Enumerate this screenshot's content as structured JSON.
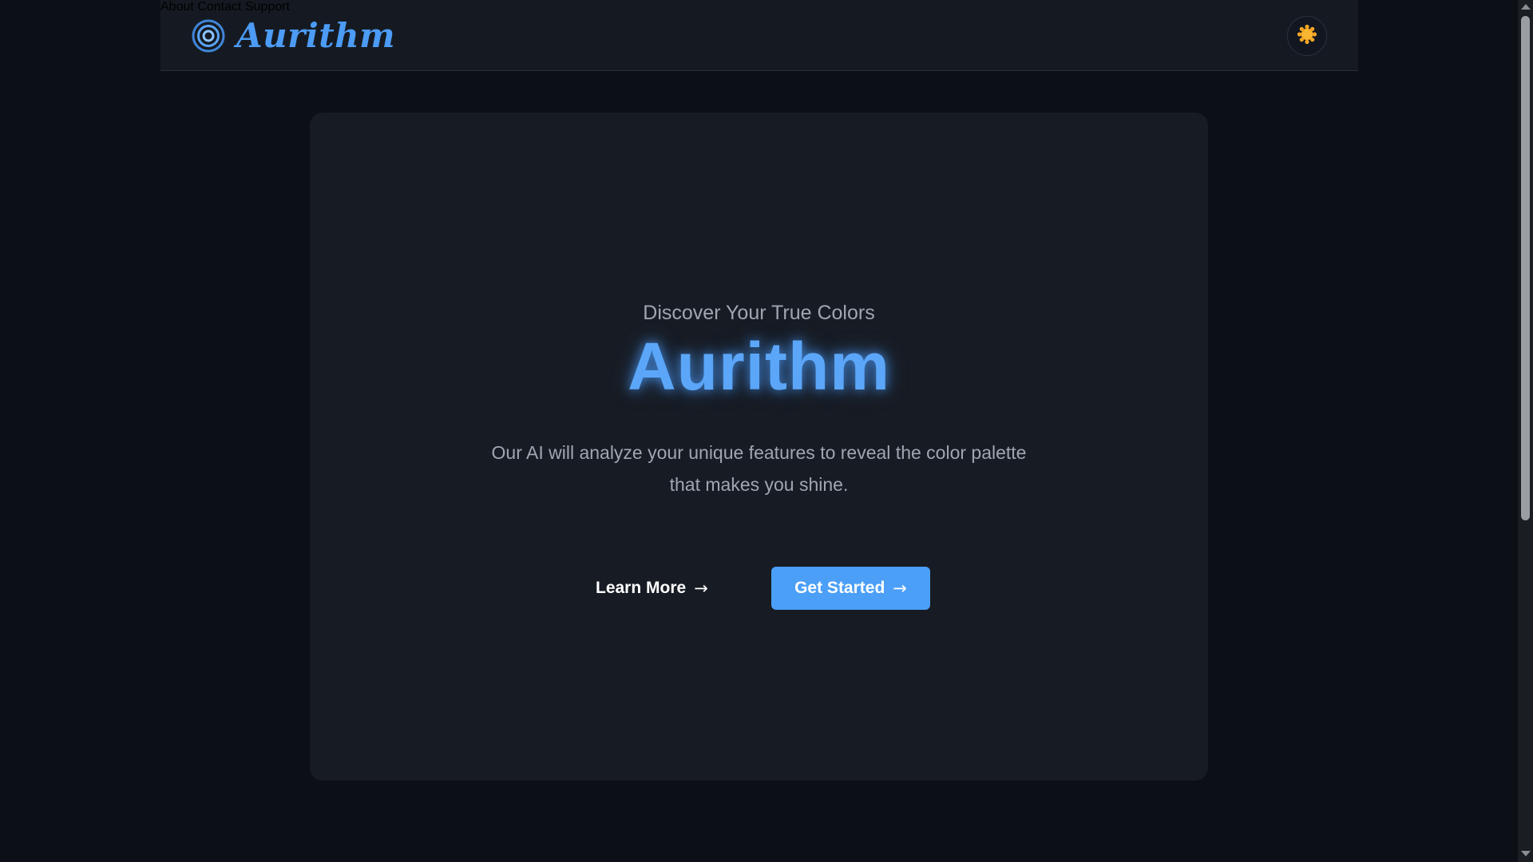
{
  "header": {
    "logo_text": "Aurithm",
    "nav": {
      "about": "About",
      "contact": "Contact",
      "support": "Support"
    },
    "theme_toggle_icon": "sun-icon"
  },
  "hero": {
    "tagline": "Discover Your True Colors",
    "title": "Aurithm",
    "description": "Our AI will analyze your unique features to reveal the color palette that makes you shine.",
    "learn_more_label": "Learn More",
    "get_started_label": "Get Started",
    "arrow": "→"
  },
  "colors": {
    "accent": "#4b9ff7",
    "background": "#0c0f15",
    "card": "#171b23",
    "sun": "#f5a623"
  }
}
